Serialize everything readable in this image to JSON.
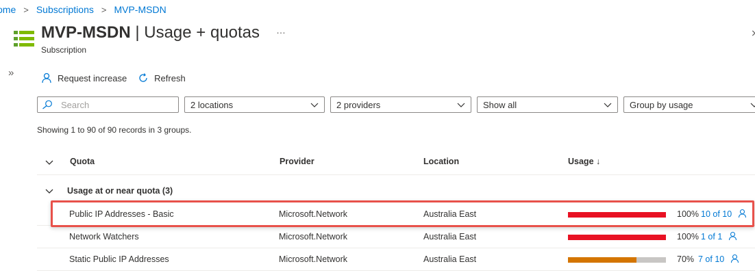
{
  "breadcrumb": {
    "home": "ome",
    "subscriptions": "Subscriptions",
    "current": "MVP-MSDN"
  },
  "header": {
    "title_bold": "MVP-MSDN",
    "title_rest": " | Usage + quotas",
    "subtitle": "Subscription",
    "more": "…",
    "close": "⨯"
  },
  "toolbar": {
    "request_increase": "Request increase",
    "refresh": "Refresh"
  },
  "filters": {
    "search_placeholder": "Search",
    "locations": "2 locations",
    "providers": "2 providers",
    "show": "Show all",
    "group": "Group by usage"
  },
  "records_text": "Showing 1 to 90 of 90 records in 3 groups.",
  "columns": {
    "quota": "Quota",
    "provider": "Provider",
    "location": "Location",
    "usage": "Usage ↓"
  },
  "group": {
    "label": "Usage at or near quota (3)"
  },
  "rows": [
    {
      "quota": "Public IP Addresses - Basic",
      "provider": "Microsoft.Network",
      "location": "Australia East",
      "usage_fraction": 1.0,
      "pct": "100%",
      "count": "10 of 10",
      "bar_color": "#e81123"
    },
    {
      "quota": "Network Watchers",
      "provider": "Microsoft.Network",
      "location": "Australia East",
      "usage_fraction": 1.0,
      "pct": "100%",
      "count": "1 of 1",
      "bar_color": "#e81123"
    },
    {
      "quota": "Static Public IP Addresses",
      "provider": "Microsoft.Network",
      "location": "Australia East",
      "usage_fraction": 0.7,
      "pct": "70%",
      "count": "7 of 10",
      "bar_color": "#d47500"
    }
  ],
  "colors": {
    "accent": "#0078d4",
    "critical": "#e81123",
    "warning": "#d47500",
    "highlight_border": "#e8514a"
  },
  "icons": {
    "header": "quota-list-icon",
    "request": "person-icon",
    "refresh": "refresh-icon",
    "expand": "double-chevron-right-icon"
  }
}
